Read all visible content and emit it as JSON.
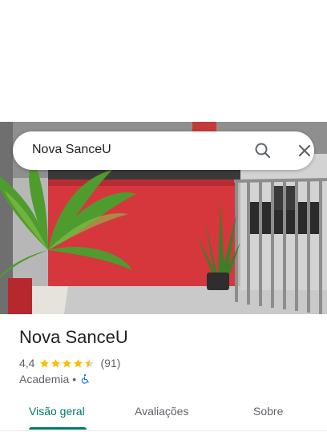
{
  "search": {
    "query": "Nova SanceU"
  },
  "place": {
    "name": "Nova SanceU",
    "rating": "4,4",
    "rating_value": 4.4,
    "review_count": "(91)",
    "category": "Academia",
    "separator": "•",
    "accessibility_icon": "wheelchair-icon"
  },
  "tabs": [
    {
      "label": "Visão geral",
      "active": true
    },
    {
      "label": "Avaliações",
      "active": false
    },
    {
      "label": "Sobre",
      "active": false
    }
  ],
  "colors": {
    "accent": "#00796b",
    "star": "#fbbc04",
    "accessibility": "#1a73e8"
  }
}
